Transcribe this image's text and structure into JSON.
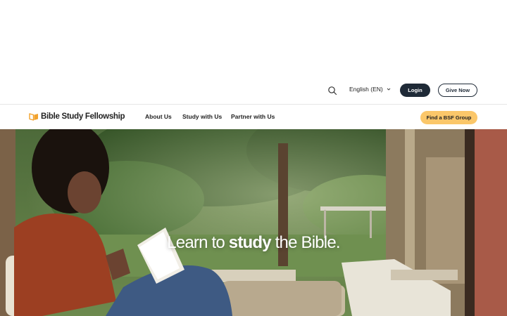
{
  "utility": {
    "search_icon": "search-icon",
    "language": "English (EN)",
    "login_label": "Login",
    "give_label": "Give Now"
  },
  "nav": {
    "logo_text": "Bible Study Fellowship",
    "logo_icon": "open-book-icon",
    "links": [
      "About Us",
      "Study with Us",
      "Partner with Us"
    ],
    "cta_label": "Find a BSF Group"
  },
  "hero": {
    "tagline_before": "Learn to",
    "tagline_emphasis": "study",
    "tagline_after": "the Bible."
  },
  "colors": {
    "login_bg": "#1f2a37",
    "cta_bg": "#fbc76a",
    "logo_accent": "#f2a22c"
  }
}
